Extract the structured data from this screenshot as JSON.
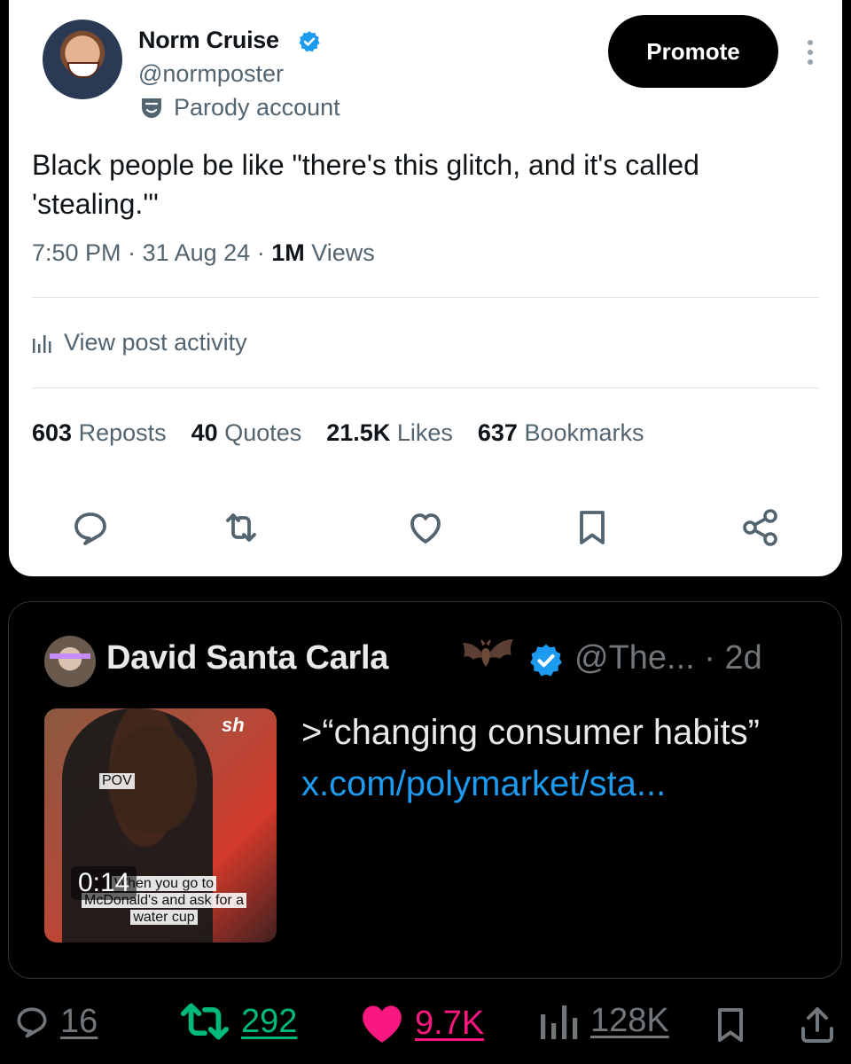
{
  "post": {
    "author_name": "Norm Cruise",
    "handle": "@normposter",
    "parody_label": "Parody account",
    "promote_label": "Promote",
    "text": "Black people be like \"there's this glitch, and it's called 'stealing.'\"",
    "time": "7:50 PM",
    "date": "31 Aug 24",
    "views_count": "1M",
    "views_label": "Views",
    "activity_label": "View post activity",
    "stats": {
      "reposts_count": "603",
      "reposts_label": "Reposts",
      "quotes_count": "40",
      "quotes_label": "Quotes",
      "likes_count": "21.5K",
      "likes_label": "Likes",
      "bookmarks_count": "637",
      "bookmarks_label": "Bookmarks"
    },
    "actions": [
      "reply-icon",
      "repost-icon",
      "like-icon",
      "bookmark-icon",
      "share-icon"
    ]
  },
  "quoted_post": {
    "author_name": "David Santa Carla",
    "handle": "@The...",
    "age": "· 2d",
    "text_prefix": ">“changing consumer habits”",
    "link_text": "x.com/polymarket/sta...",
    "video": {
      "duration": "0:14",
      "pov_text": "POV",
      "sign_text": "sh",
      "caption_line1": "When you go to",
      "caption_line2": "McDonald's and ask for a",
      "caption_line3": "water cup"
    }
  },
  "engagement_bar": {
    "replies": "16",
    "reposts": "292",
    "likes": "9.7K",
    "views": "128K"
  },
  "colors": {
    "verified_blue": "#1d9bf0",
    "repost_green": "#00ba7c",
    "like_pink": "#f91880",
    "muted_gray": "#71767b"
  }
}
